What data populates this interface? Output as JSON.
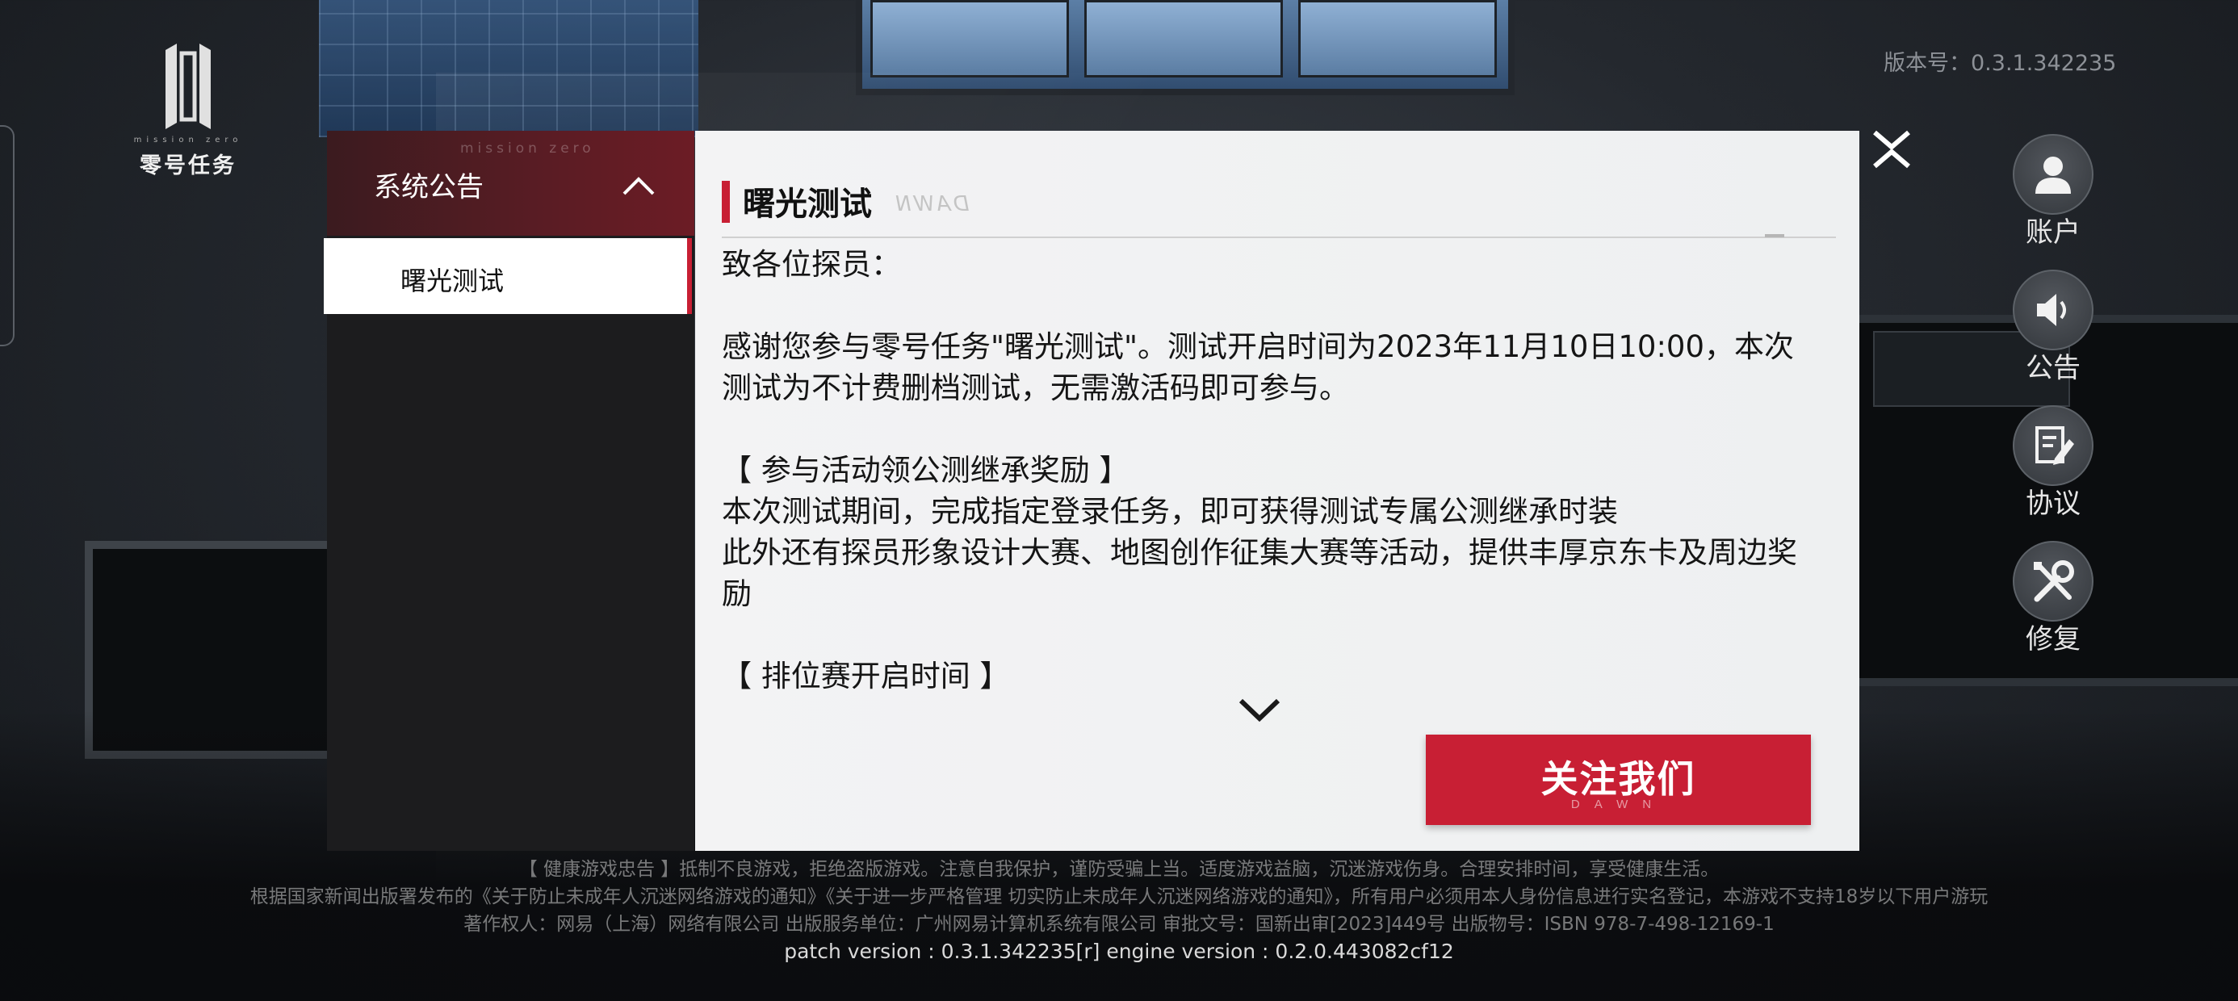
{
  "logo": {
    "subtitle_en": "mission zero",
    "title_cn": "零号任务"
  },
  "version": "版本号：0.3.1.342235",
  "sidebar": {
    "watermark": "mission zero",
    "title": "系统公告",
    "items": [
      {
        "label": "曙光测试",
        "selected": true
      }
    ]
  },
  "notice": {
    "title": "曙光测试",
    "title_watermark": "DAWN",
    "paragraphs": [
      "致各位探员：",
      "",
      "感谢您参与零号任务\"曙光测试\"。测试开启时间为2023年11月10日10:00，本次测试为不计费删档测试，无需激活码即可参与。",
      "",
      "【 参与活动领公测继承奖励 】",
      "本次测试期间，完成指定登录任务，即可获得测试专属公测继承时装",
      "此外还有探员形象设计大赛、地图创作征集大赛等活动，提供丰厚京东卡及周边奖励",
      "",
      "【 排位赛开启时间 】"
    ],
    "follow_button": "关注我们",
    "follow_button_sub": "DAWN"
  },
  "side_menu": [
    {
      "label": "账户",
      "icon": "user-icon"
    },
    {
      "label": "公告",
      "icon": "speaker-icon"
    },
    {
      "label": "协议",
      "icon": "edit-document-icon"
    },
    {
      "label": "修复",
      "icon": "wrench-screwdriver-icon"
    }
  ],
  "footer": {
    "health_notice": "【 健康游戏忠告 】抵制不良游戏，拒绝盗版游戏。注意自我保护，谨防受骗上当。适度游戏益脑，沉迷游戏伤身。合理安排时间，享受健康生活。",
    "regulation": "根据国家新闻出版署发布的《关于防止未成年人沉迷网络游戏的通知》《关于进一步严格管理 切实防止未成年人沉迷网络游戏的通知》，所有用户必须用本人身份信息进行实名登记，本游戏不支持18岁以下用户游玩",
    "copyright": "著作权人：网易（上海）网络有限公司  出版服务单位：广州网易计算机系统有限公司  审批文号：国新出审[2023]449号  出版物号：ISBN 978-7-498-12169-1",
    "patch": "patch version : 0.3.1.342235[r] engine version : 0.2.0.443082cf12"
  },
  "colors": {
    "accent_red": "#c81f34",
    "sidebar_bg": "#1c1c1e",
    "content_bg": "#f0f1f2"
  }
}
